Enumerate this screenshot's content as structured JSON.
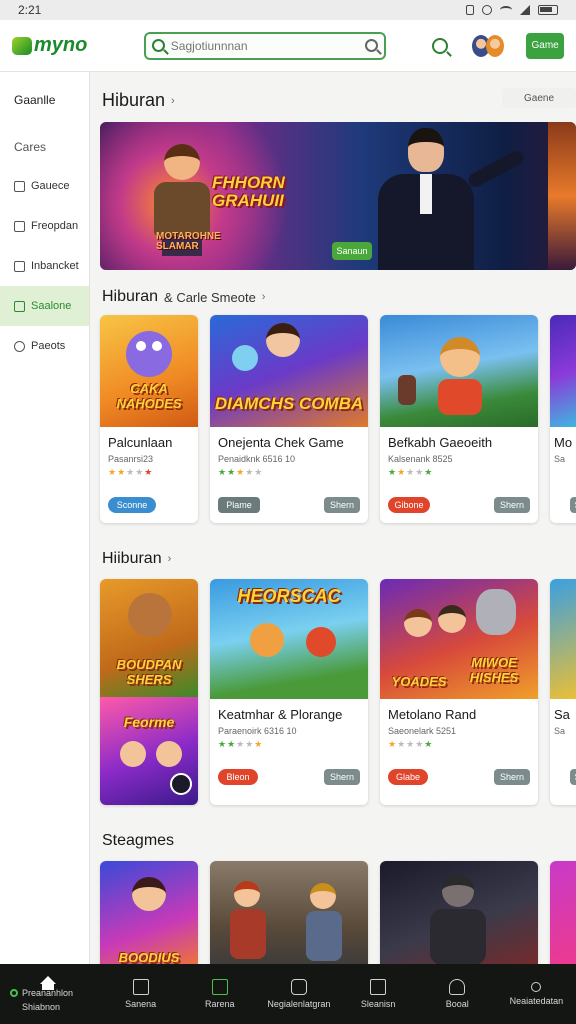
{
  "status_bar": {
    "time": "2:21"
  },
  "app": {
    "logo_text": "myno",
    "search_placeholder": "Sagjotiunnnan",
    "header_button": "Game"
  },
  "sidebar": {
    "title": "Gaanlle",
    "items": [
      {
        "label": "Cares",
        "active": false,
        "icon": ""
      },
      {
        "label": "Gauece",
        "active": false,
        "icon": "box-icon"
      },
      {
        "label": "Freopdan",
        "active": false,
        "icon": "lock-icon"
      },
      {
        "label": "Inbancket",
        "active": false,
        "icon": "box-icon"
      },
      {
        "label": "Saalone",
        "active": true,
        "icon": "grid-icon"
      },
      {
        "label": "Paeots",
        "active": false,
        "icon": "chat-icon"
      }
    ]
  },
  "main": {
    "section1": {
      "title": "Hiburan",
      "chevron": "›",
      "dropdown": "Gaene"
    },
    "banner": {
      "title": "FHHORN GRAHUII",
      "caption_line1": "MOTAROHNE",
      "caption_line2": "SLAMAR",
      "button": "Sanaun"
    },
    "section2": {
      "title": "Hiburan",
      "subtitle": "& Carle Smeote",
      "chevron": "›"
    },
    "row1": [
      {
        "thumb_text": "CAKA NAHODES",
        "title": "Palcunlaan",
        "meta": "Pasanrsi23",
        "stars": "★★★★★",
        "btn_left": "Sconne",
        "btn_right": ""
      },
      {
        "thumb_text": "DIAMCHS COMBA",
        "title": "Onejenta Chek Game",
        "meta": "Penaidknk 6516 10",
        "stars": "★★★★★",
        "btn_left": "Plame",
        "btn_right": "Shern"
      },
      {
        "thumb_text": "",
        "title": "Befkabh Gaeoeith",
        "meta": "Kalsenank 8525",
        "stars": "★★★★★",
        "btn_left": "Gibone",
        "btn_right": "Shern"
      },
      {
        "thumb_text": "",
        "title": "Mo",
        "meta": "Sa",
        "stars": "",
        "btn_left": "",
        "btn_right": "Sh"
      }
    ],
    "section3": {
      "title": "Hiiburan",
      "chevron": "›"
    },
    "row2": [
      {
        "thumb_text": "BOUDPAN SHERS",
        "thumb2_text": "Feorme",
        "title": "",
        "meta": "",
        "stars": "",
        "btn_left": "",
        "btn_right": ""
      },
      {
        "thumb_text": "HEORSCAC",
        "title": "Keatmhar & Plorange",
        "meta": "Paraenoirk 6316 10",
        "stars": "★★★★★",
        "btn_left": "Bleon",
        "btn_right": "Shern"
      },
      {
        "thumb_text": "MIWOE HISHES",
        "thumb_sub": "YOADES",
        "title": "Metolano Rand",
        "meta": "Saeonelark 5251",
        "stars": "★★★★★",
        "btn_left": "Glabe",
        "btn_right": "Shern"
      },
      {
        "thumb_text": "",
        "title": "Sa",
        "meta": "Sa",
        "stars": "",
        "btn_left": "",
        "btn_right": "Sh"
      }
    ],
    "section4": {
      "title": "Steagmes"
    },
    "row3": [
      {
        "thumb_text": "BOODIUS"
      },
      {
        "thumb_text": ""
      },
      {
        "thumb_text": ""
      },
      {
        "thumb_text": ""
      }
    ]
  },
  "bottom_nav": [
    {
      "label": "Preananhlon",
      "label2": "Shiabnon",
      "icon": "home-icon"
    },
    {
      "label": "Sanena",
      "icon": "bag-icon"
    },
    {
      "label": "Rarena",
      "icon": "doc-icon"
    },
    {
      "label": "Negialenlatgran",
      "icon": "phone-icon"
    },
    {
      "label": "Sleanisn",
      "icon": "box-icon"
    },
    {
      "label": "Booal",
      "icon": "person-icon"
    },
    {
      "label": "Neaiatedatan",
      "icon": "dot-icon"
    }
  ]
}
